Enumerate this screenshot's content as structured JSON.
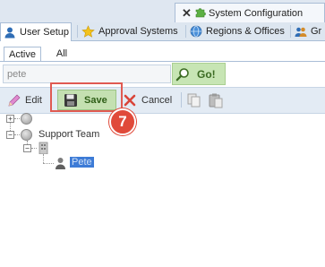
{
  "doc_tab": {
    "close_glyph": "✕",
    "title": "System Configuration",
    "icon": "puzzle-icon"
  },
  "module_tabs": [
    {
      "label": "User Setup",
      "icon": "user-icon",
      "active": true
    },
    {
      "label": "Approval Systems",
      "icon": "star-icon",
      "active": false
    },
    {
      "label": "Regions & Offices",
      "icon": "globe-icon",
      "active": false
    },
    {
      "label": "Gr",
      "icon": "group-icon",
      "active": false
    }
  ],
  "sub_tabs": [
    {
      "label": "Active",
      "active": true
    },
    {
      "label": "All",
      "active": false
    }
  ],
  "search": {
    "value": "pete",
    "go_label": "Go!"
  },
  "toolbar": {
    "edit_label": "Edit",
    "save_label": "Save",
    "cancel_label": "Cancel"
  },
  "callout": {
    "step": "7"
  },
  "tree": {
    "root_toggle": "+",
    "team_toggle": "−",
    "team_label": "Support Team",
    "office_toggle": "−",
    "user_label": "Pete"
  },
  "colors": {
    "save_green": "#c4e0b1",
    "callout_red": "#e04a3a",
    "selection_blue": "#3d7bd6"
  }
}
